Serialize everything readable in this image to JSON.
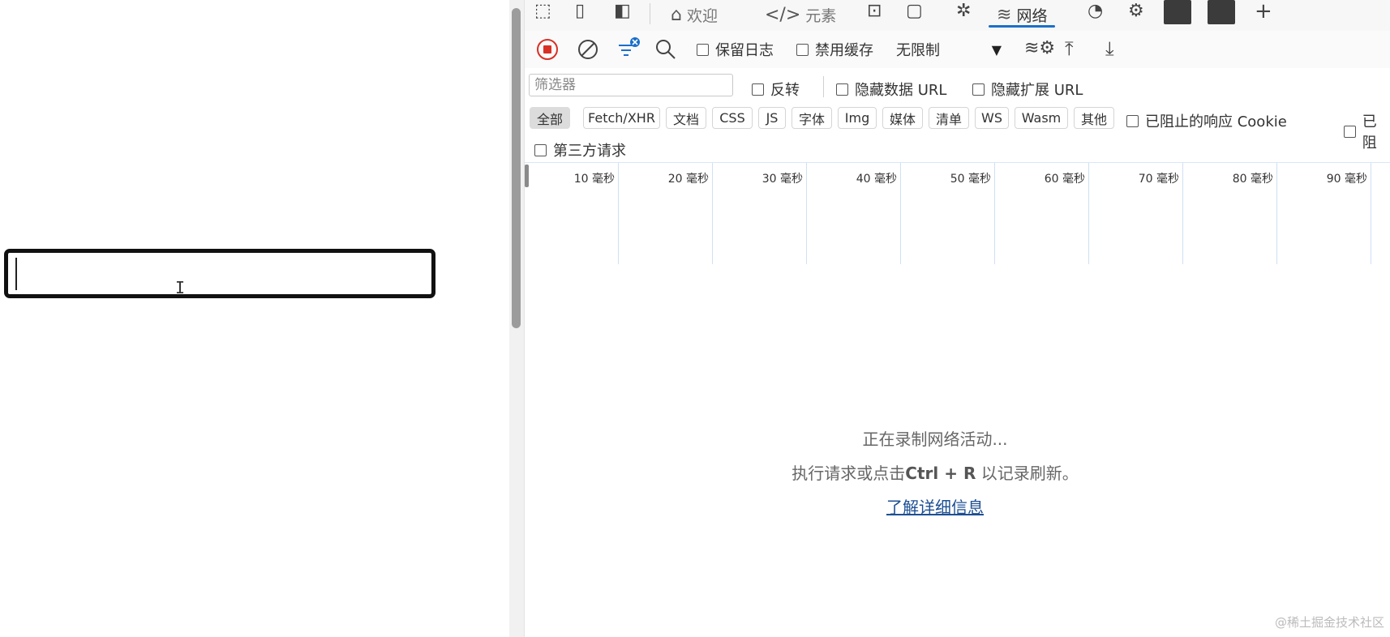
{
  "page": {
    "input_value": ""
  },
  "devtools": {
    "tabs": [
      {
        "label": "欢迎",
        "icon": "home-icon"
      },
      {
        "label": "元素",
        "icon": "code-icon"
      },
      {
        "label": "网络",
        "icon": "wifi-icon",
        "active": true
      }
    ],
    "toolbar": {
      "preserve_log": "保留日志",
      "disable_cache": "禁用缓存",
      "throttling": "无限制"
    },
    "filter": {
      "placeholder": "筛选器",
      "invert": "反转",
      "hide_data_urls": "隐藏数据 URL",
      "hide_extension_urls": "隐藏扩展 URL"
    },
    "types": [
      "全部",
      "Fetch/XHR",
      "文档",
      "CSS",
      "JS",
      "字体",
      "Img",
      "媒体",
      "清单",
      "WS",
      "Wasm",
      "其他"
    ],
    "blocked_cookies": "已阻止的响应 Cookie",
    "blocked_requests_partial": "已阻",
    "third_party": "第三方请求",
    "timeline_ticks": [
      "10 毫秒",
      "20 毫秒",
      "30 毫秒",
      "40 毫秒",
      "50 毫秒",
      "60 毫秒",
      "70 毫秒",
      "80 毫秒",
      "90 毫秒"
    ],
    "empty": {
      "line1": "正在录制网络活动...",
      "line2_prefix": "执行请求或点击",
      "line2_shortcut": "Ctrl + R",
      "line2_suffix": " 以记录刷新。",
      "link": "了解详细信息"
    }
  },
  "watermark": "@稀土掘金技术社区",
  "colors": {
    "accent": "#1a6fc9",
    "record": "#d93025",
    "link": "#1d4f93"
  }
}
